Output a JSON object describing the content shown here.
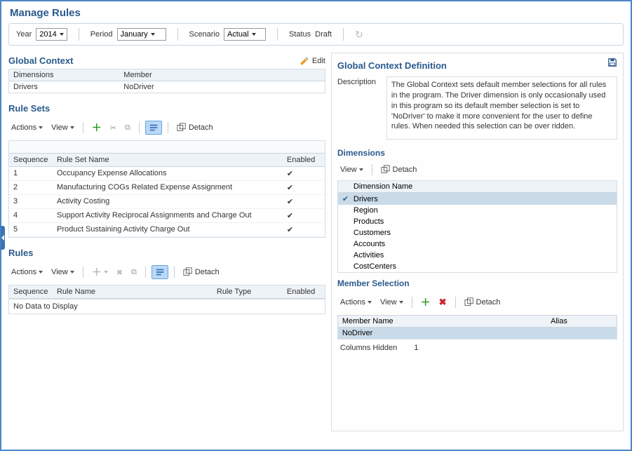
{
  "title": "Manage Rules",
  "filters": {
    "year_label": "Year",
    "year_value": "2014",
    "period_label": "Period",
    "period_value": "January",
    "scenario_label": "Scenario",
    "scenario_value": "Actual",
    "status_label": "Status",
    "status_value": "Draft"
  },
  "global_context": {
    "title": "Global Context",
    "edit_label": "Edit",
    "col_dimensions": "Dimensions",
    "col_member": "Member",
    "rows": [
      {
        "dimension": "Drivers",
        "member": "NoDriver"
      }
    ]
  },
  "rule_sets": {
    "title": "Rule Sets",
    "actions_label": "Actions",
    "view_label": "View",
    "detach_label": "Detach",
    "col_sequence": "Sequence",
    "col_name": "Rule Set Name",
    "col_enabled": "Enabled",
    "rows": [
      {
        "seq": "1",
        "name": "Occupancy Expense Allocations",
        "enabled": true
      },
      {
        "seq": "2",
        "name": "Manufacturing COGs Related Expense Assignment",
        "enabled": true
      },
      {
        "seq": "3",
        "name": "Activity Costing",
        "enabled": true
      },
      {
        "seq": "4",
        "name": "Support Activity Reciprocal Assignments and Charge Out",
        "enabled": true
      },
      {
        "seq": "5",
        "name": "Product Sustaining Activity Charge Out",
        "enabled": true
      }
    ]
  },
  "rules": {
    "title": "Rules",
    "actions_label": "Actions",
    "view_label": "View",
    "detach_label": "Detach",
    "col_sequence": "Sequence",
    "col_name": "Rule Name",
    "col_type": "Rule Type",
    "col_enabled": "Enabled",
    "nodata": "No Data to Display"
  },
  "definition": {
    "title": "Global Context Definition",
    "desc_label": "Description",
    "desc_text": "The Global Context sets default member selections for all rules in the program. The Driver dimension is only occasionally used in this program so its default member selection is set to 'NoDriver' to make it more convenient for the user to define rules. When needed this selection can be over ridden."
  },
  "dimensions": {
    "title": "Dimensions",
    "view_label": "View",
    "detach_label": "Detach",
    "col_name": "Dimension Name",
    "rows": [
      {
        "name": "Drivers",
        "selected": true
      },
      {
        "name": "Region"
      },
      {
        "name": "Products"
      },
      {
        "name": "Customers"
      },
      {
        "name": "Accounts"
      },
      {
        "name": "Activities"
      },
      {
        "name": "CostCenters"
      }
    ]
  },
  "member_selection": {
    "title": "Member Selection",
    "actions_label": "Actions",
    "view_label": "View",
    "detach_label": "Detach",
    "col_name": "Member Name",
    "col_alias": "Alias",
    "rows": [
      {
        "name": "NoDriver",
        "alias": ""
      }
    ],
    "cols_hidden_label": "Columns Hidden",
    "cols_hidden_count": "1"
  }
}
